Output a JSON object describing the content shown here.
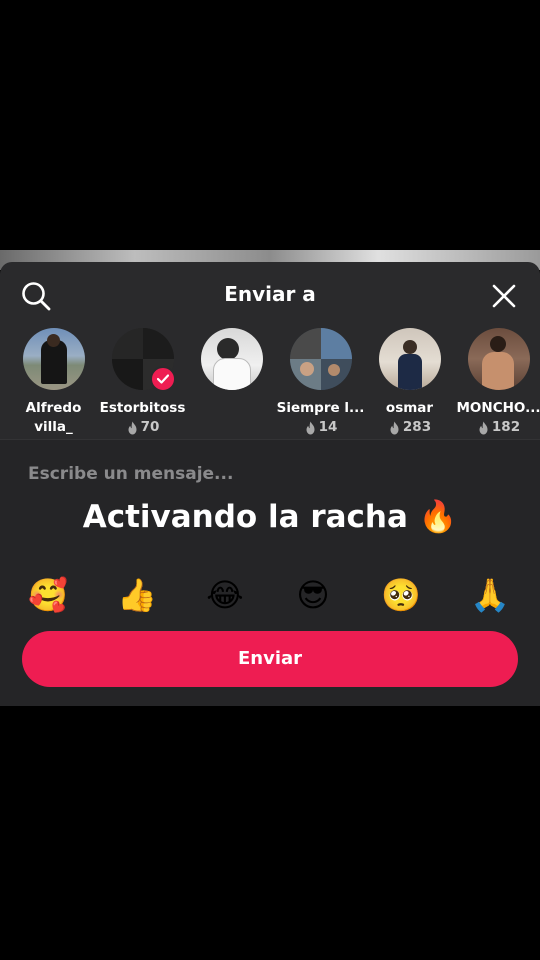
{
  "header": {
    "title": "Enviar a"
  },
  "contacts": [
    {
      "line1": "Alfredo",
      "line2": "villa_",
      "streak": "",
      "selected": false
    },
    {
      "line1": "Estorbitoss",
      "line2": "",
      "streak": "70",
      "selected": true
    },
    {
      "line1": "",
      "line2": "",
      "streak": "",
      "selected": false
    },
    {
      "line1": "Siempre l...",
      "line2": "",
      "streak": "14",
      "selected": false
    },
    {
      "line1": "osmar",
      "line2": "",
      "streak": "283",
      "selected": false
    },
    {
      "line1": "MONCHO...",
      "line2": "",
      "streak": "182",
      "selected": false
    }
  ],
  "compose": {
    "placeholder": "Escribe un mensaje...",
    "message": "Activando la racha 🔥"
  },
  "emojis": [
    "🥰",
    "👍",
    "😂",
    "😎",
    "🥺",
    "🙏"
  ],
  "send": {
    "label": "Enviar"
  },
  "colors": {
    "accent": "#ee1d52",
    "sheet_bg": "#2a2a2c",
    "compose_bg": "#252527"
  }
}
